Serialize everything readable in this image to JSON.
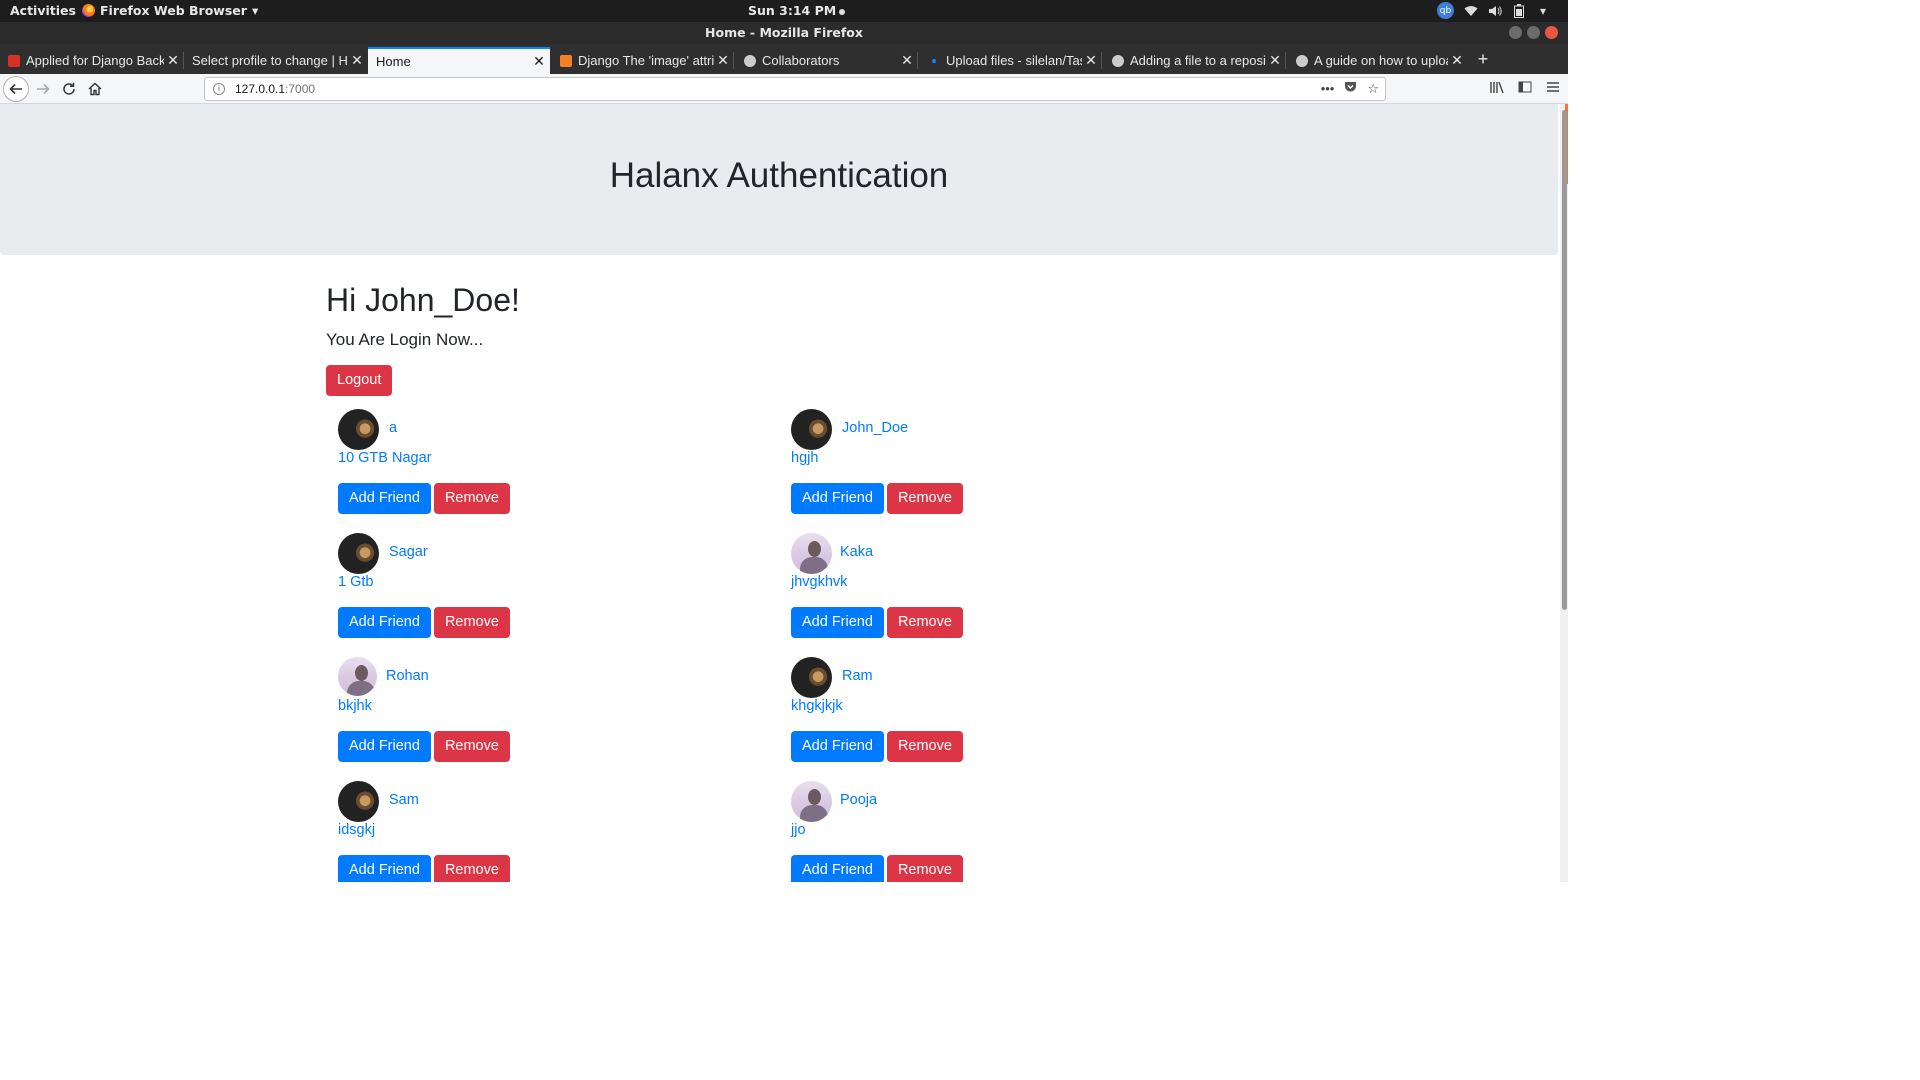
{
  "system": {
    "activities": "Activities",
    "app_menu": "Firefox Web Browser",
    "clock": "Sun  3:14 PM",
    "user_initials": "qb"
  },
  "window": {
    "title": "Home - Mozilla Firefox"
  },
  "tabs": [
    {
      "label": "Applied for Django Back",
      "favicon_color": "#d93025",
      "active": false
    },
    {
      "label": "Select profile to change | Ha",
      "favicon_color": "",
      "active": false
    },
    {
      "label": "Home",
      "favicon_color": "",
      "active": true
    },
    {
      "label": "Django The 'image' attrib",
      "favicon_color": "#f48024",
      "active": false
    },
    {
      "label": "Collaborators",
      "favicon_color": "#cccccc",
      "active": false
    },
    {
      "label": "Upload files - silelan/Tas",
      "favicon_color": "#0a84ff",
      "active": false
    },
    {
      "label": "Adding a file to a reposit",
      "favicon_color": "#cccccc",
      "active": false
    },
    {
      "label": "A guide on how to uploa",
      "favicon_color": "#cccccc",
      "active": false
    }
  ],
  "url": {
    "host": "127.0.0.1",
    "port": ":7000"
  },
  "page": {
    "header_title": "Halanx Authentication",
    "greeting": "Hi John_Doe!",
    "status": "You Are Login Now...",
    "logout_label": "Logout",
    "add_friend_label": "Add Friend",
    "remove_label": "Remove"
  },
  "colors": {
    "primary": "#007bff",
    "danger": "#dc3545",
    "jumbotron": "#e9ecef"
  },
  "users": [
    {
      "name": "a",
      "address": "10 GTB Nagar",
      "avatar": "dog"
    },
    {
      "name": "John_Doe",
      "address": "hgjh",
      "avatar": "dog"
    },
    {
      "name": "Sagar",
      "address": "1 Gtb",
      "avatar": "dog"
    },
    {
      "name": "Kaka",
      "address": "jhvgkhvk",
      "avatar": "person"
    },
    {
      "name": "Rohan",
      "address": "bkjhk",
      "avatar": "person"
    },
    {
      "name": "Ram",
      "address": "khgkjkjk",
      "avatar": "dog"
    },
    {
      "name": "Sam",
      "address": "idsgkj",
      "avatar": "dog"
    },
    {
      "name": "Pooja",
      "address": "jjo",
      "avatar": "person"
    }
  ]
}
